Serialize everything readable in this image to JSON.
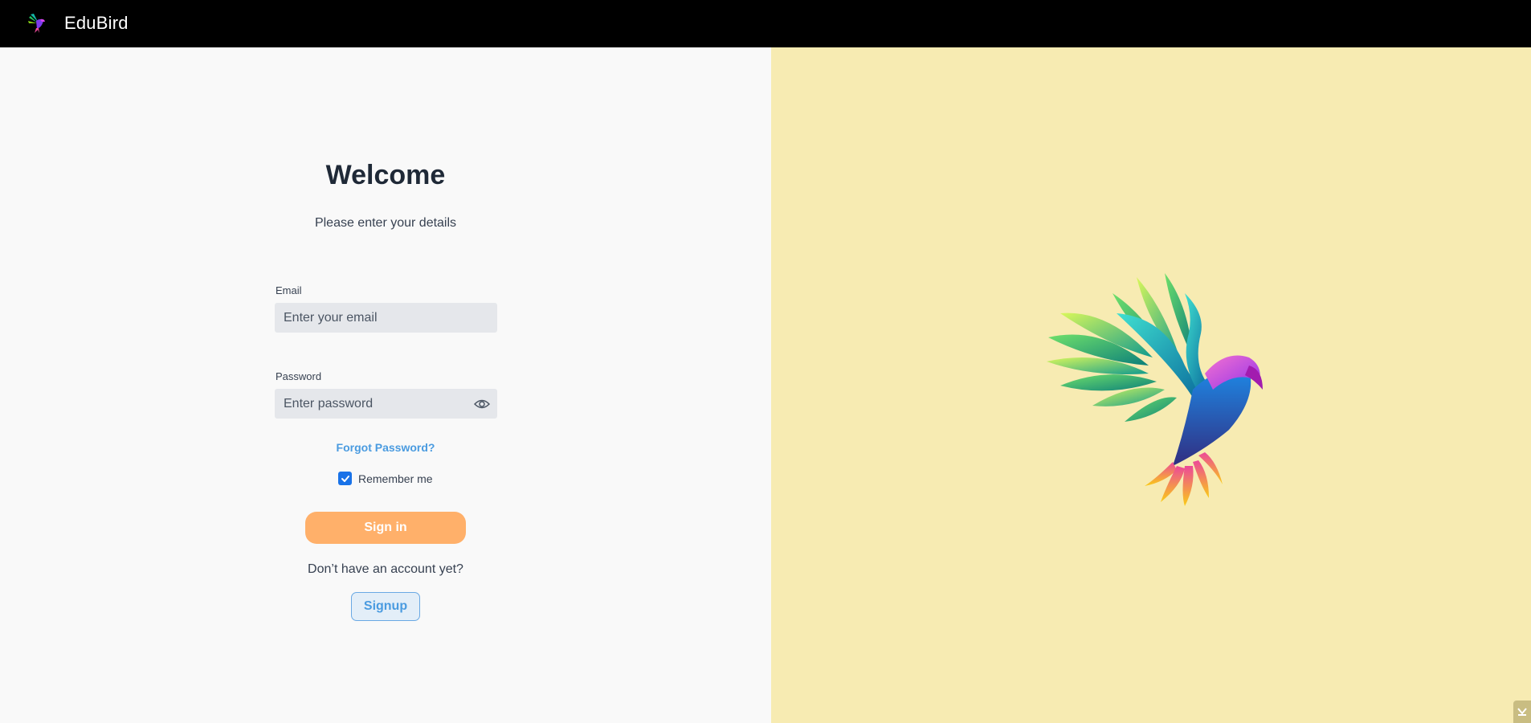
{
  "header": {
    "brand": "EduBird"
  },
  "login": {
    "title": "Welcome",
    "subtitle": "Please enter your details",
    "email_label": "Email",
    "email_placeholder": "Enter your email",
    "email_value": "",
    "password_label": "Password",
    "password_placeholder": "Enter password",
    "password_value": "",
    "forgot_label": "Forgot Password?",
    "remember_label": "Remember me",
    "remember_checked": true,
    "signin_label": "Sign in",
    "no_account_text": "Don’t have an account yet?",
    "signup_label": "Signup"
  },
  "icons": {
    "logo": "bird-logo-icon",
    "password_toggle": "eye-icon",
    "checkbox": "checkmark-icon",
    "illustration": "colorful-bird-illustration",
    "corner": "chevron-down-icon"
  },
  "colors": {
    "topbar": "#000000",
    "left_panel": "#f9f9f9",
    "right_panel": "#f7ebb2",
    "signin_button": "#ffb06a",
    "link": "#4a9be0",
    "checkbox": "#1a73e8"
  }
}
